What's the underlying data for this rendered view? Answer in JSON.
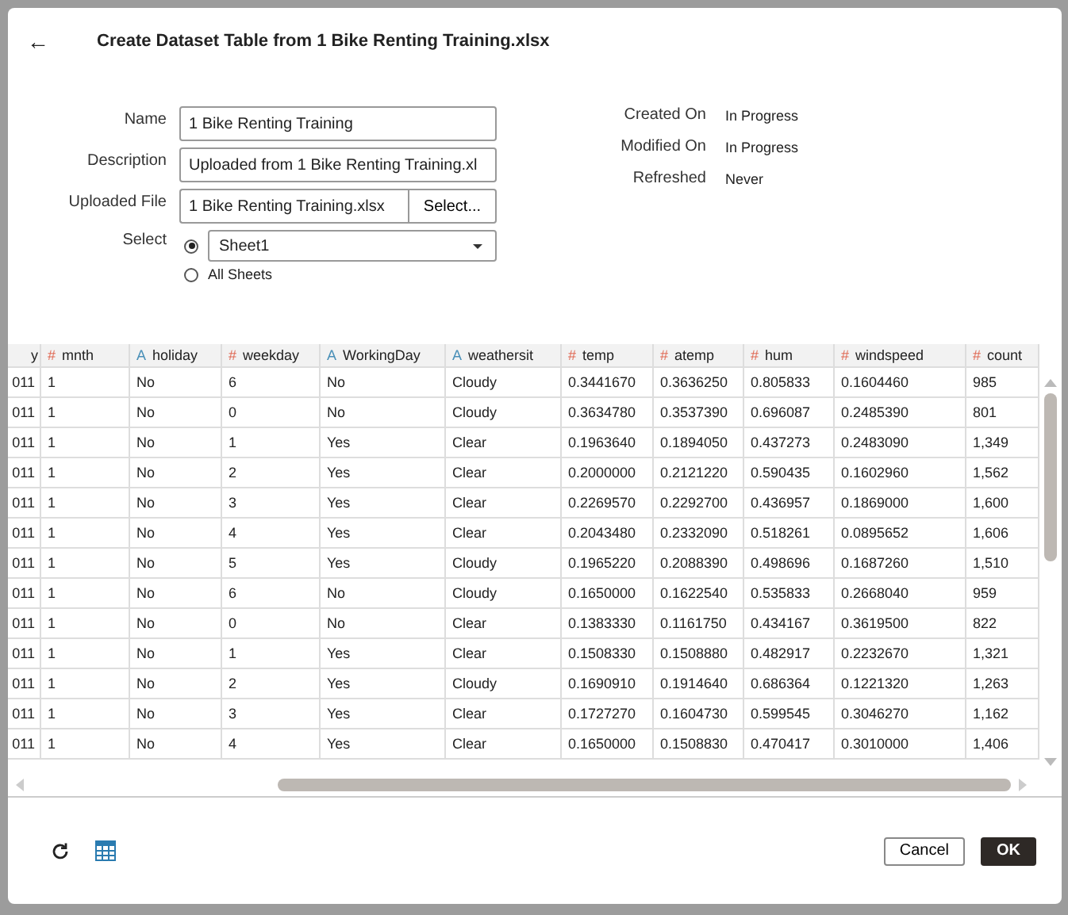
{
  "dialog": {
    "title": "Create Dataset Table from 1 Bike Renting Training.xlsx",
    "back_icon": "←"
  },
  "form": {
    "name_label": "Name",
    "name_value": "1 Bike Renting Training",
    "description_label": "Description",
    "description_value": "Uploaded from 1 Bike Renting Training.xl",
    "file_label": "Uploaded File",
    "file_value": "1 Bike Renting Training.xlsx",
    "file_button": "Select...",
    "select_label": "Select",
    "sheet_options": [
      {
        "label": "Sheet1",
        "kind": "dropdown",
        "selected": true
      },
      {
        "label": "All Sheets",
        "kind": "plain",
        "selected": false
      }
    ]
  },
  "info": [
    {
      "label": "Created On",
      "value": "In Progress"
    },
    {
      "label": "Modified On",
      "value": "In Progress"
    },
    {
      "label": "Refreshed",
      "value": "Never"
    }
  ],
  "table": {
    "columns": [
      {
        "label": "y",
        "kind": "cut"
      },
      {
        "label": "mnth",
        "kind": "number",
        "type_mark": "#"
      },
      {
        "label": "holiday",
        "kind": "text",
        "type_mark": "A"
      },
      {
        "label": "weekday",
        "kind": "number",
        "type_mark": "#"
      },
      {
        "label": "WorkingDay",
        "kind": "text",
        "type_mark": "A"
      },
      {
        "label": "weathersit",
        "kind": "text",
        "type_mark": "A"
      },
      {
        "label": "temp",
        "kind": "number",
        "type_mark": "#"
      },
      {
        "label": "atemp",
        "kind": "number",
        "type_mark": "#"
      },
      {
        "label": "hum",
        "kind": "number",
        "type_mark": "#"
      },
      {
        "label": "windspeed",
        "kind": "number",
        "type_mark": "#"
      },
      {
        "label": "count",
        "kind": "number",
        "type_mark": "#"
      }
    ],
    "rows": [
      [
        "011",
        "1",
        "No",
        "6",
        "No",
        "Cloudy",
        "0.3441670",
        "0.3636250",
        "0.805833",
        "0.1604460",
        "985"
      ],
      [
        "011",
        "1",
        "No",
        "0",
        "No",
        "Cloudy",
        "0.3634780",
        "0.3537390",
        "0.696087",
        "0.2485390",
        "801"
      ],
      [
        "011",
        "1",
        "No",
        "1",
        "Yes",
        "Clear",
        "0.1963640",
        "0.1894050",
        "0.437273",
        "0.2483090",
        "1,349"
      ],
      [
        "011",
        "1",
        "No",
        "2",
        "Yes",
        "Clear",
        "0.2000000",
        "0.2121220",
        "0.590435",
        "0.1602960",
        "1,562"
      ],
      [
        "011",
        "1",
        "No",
        "3",
        "Yes",
        "Clear",
        "0.2269570",
        "0.2292700",
        "0.436957",
        "0.1869000",
        "1,600"
      ],
      [
        "011",
        "1",
        "No",
        "4",
        "Yes",
        "Clear",
        "0.2043480",
        "0.2332090",
        "0.518261",
        "0.0895652",
        "1,606"
      ],
      [
        "011",
        "1",
        "No",
        "5",
        "Yes",
        "Cloudy",
        "0.1965220",
        "0.2088390",
        "0.498696",
        "0.1687260",
        "1,510"
      ],
      [
        "011",
        "1",
        "No",
        "6",
        "No",
        "Cloudy",
        "0.1650000",
        "0.1622540",
        "0.535833",
        "0.2668040",
        "959"
      ],
      [
        "011",
        "1",
        "No",
        "0",
        "No",
        "Clear",
        "0.1383330",
        "0.1161750",
        "0.434167",
        "0.3619500",
        "822"
      ],
      [
        "011",
        "1",
        "No",
        "1",
        "Yes",
        "Clear",
        "0.1508330",
        "0.1508880",
        "0.482917",
        "0.2232670",
        "1,321"
      ],
      [
        "011",
        "1",
        "No",
        "2",
        "Yes",
        "Cloudy",
        "0.1690910",
        "0.1914640",
        "0.686364",
        "0.1221320",
        "1,263"
      ],
      [
        "011",
        "1",
        "No",
        "3",
        "Yes",
        "Clear",
        "0.1727270",
        "0.1604730",
        "0.599545",
        "0.3046270",
        "1,162"
      ],
      [
        "011",
        "1",
        "No",
        "4",
        "Yes",
        "Clear",
        "0.1650000",
        "0.1508830",
        "0.470417",
        "0.3010000",
        "1,406"
      ]
    ]
  },
  "footer": {
    "cancel": "Cancel",
    "ok": "OK"
  }
}
